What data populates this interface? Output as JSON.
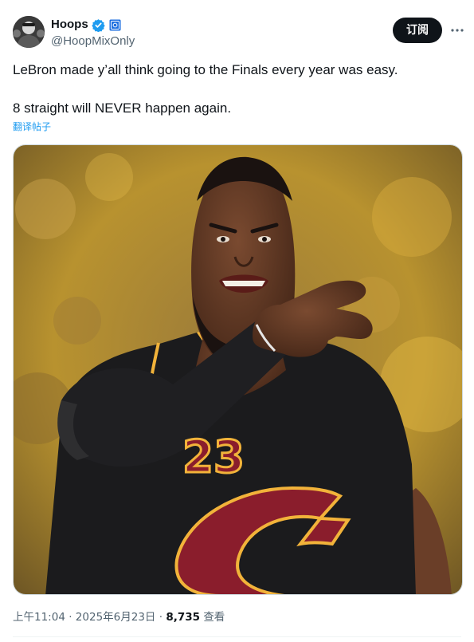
{
  "author": {
    "display_name": "Hoops",
    "handle": "@HoopMixOnly",
    "verified": true,
    "avatar_icon": "person-avatar"
  },
  "actions": {
    "subscribe_label": "订阅",
    "more_icon": "more-horizontal-icon"
  },
  "tweet": {
    "line1": "LeBron made y’all think going to the Finals every year was easy.",
    "line2": "8 straight will NEVER happen again.",
    "translate_label": "翻译帖子"
  },
  "media": {
    "jersey_number": "23"
  },
  "meta": {
    "time": "上午11:04",
    "date": "2025年6月23日",
    "separator": "·",
    "views": "8,735",
    "views_label": "查看"
  },
  "colors": {
    "accent": "#1d9bf0",
    "text": "#0f1419",
    "secondary_text": "#536471",
    "jersey_gold": "#f2b33a",
    "jersey_wine": "#8a1d2c"
  }
}
